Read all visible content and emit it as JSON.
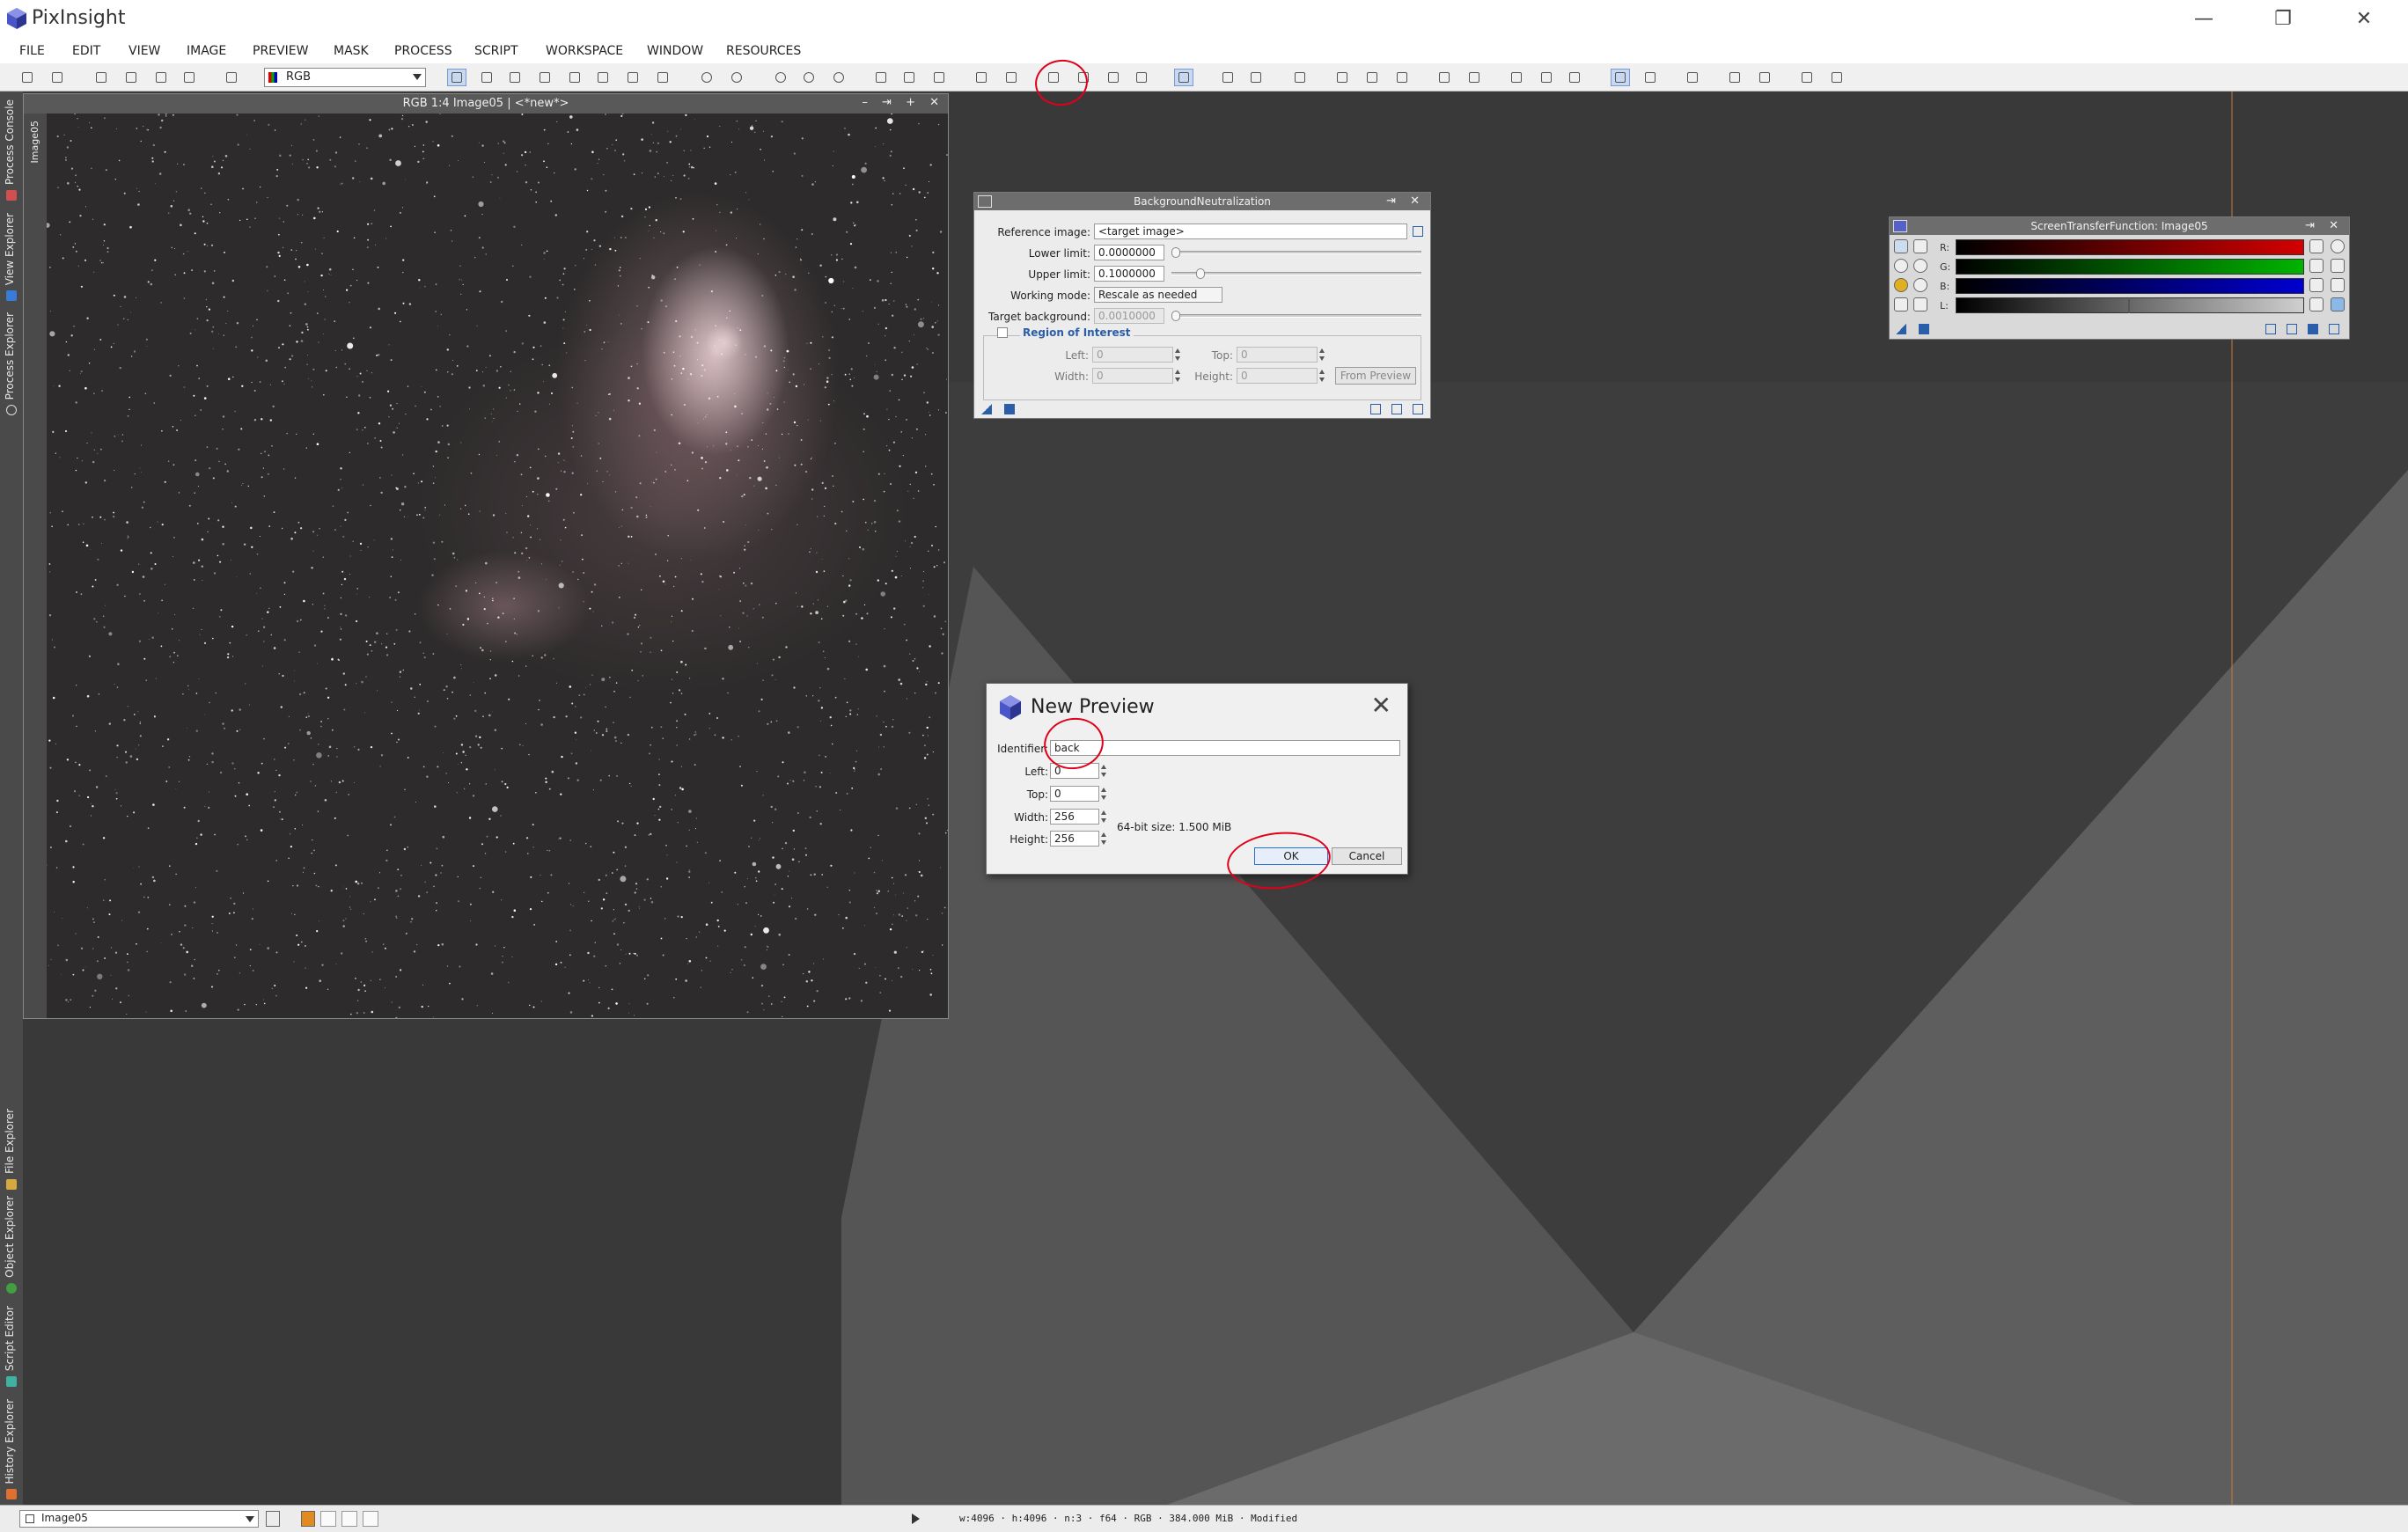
{
  "app": {
    "title": "PixInsight",
    "minimize": "—",
    "restore": "❐",
    "close": "✕"
  },
  "menu": [
    "FILE",
    "EDIT",
    "VIEW",
    "IMAGE",
    "PREVIEW",
    "MASK",
    "PROCESS",
    "SCRIPT",
    "WORKSPACE",
    "WINDOW",
    "RESOURCES"
  ],
  "toolbar": {
    "view_selector": "RGB"
  },
  "left_dock": {
    "tabs": [
      "Process Console",
      "View Explorer",
      "Process Explorer",
      "File Explorer",
      "Object Explorer",
      "Script Editor",
      "History Explorer"
    ]
  },
  "image_window": {
    "title": "RGB 1:4 Image05 | <*new*>",
    "side_label": "Image05",
    "controls": "– ⇥ + ✕"
  },
  "background_neutralization": {
    "title": "BackgroundNeutralization",
    "controls": "⇥ ✕",
    "reference_image_label": "Reference image:",
    "reference_image_value": "<target image>",
    "lower_limit_label": "Lower limit:",
    "lower_limit_value": "0.0000000",
    "upper_limit_label": "Upper limit:",
    "upper_limit_value": "0.1000000",
    "working_mode_label": "Working mode:",
    "working_mode_value": "Rescale as needed",
    "target_background_label": "Target background:",
    "target_background_value": "0.0010000",
    "roi_label": "Region of Interest",
    "left_label": "Left:",
    "left_value": "0",
    "top_label": "Top:",
    "top_value": "0",
    "width_label": "Width:",
    "width_value": "0",
    "height_label": "Height:",
    "height_value": "0",
    "from_preview": "From Preview"
  },
  "stf": {
    "title": "ScreenTransferFunction: Image05",
    "controls": "⇥ ✕",
    "channels": [
      {
        "label": "R:",
        "color": "#d40000"
      },
      {
        "label": "G:",
        "color": "#00b400"
      },
      {
        "label": "B:",
        "color": "#0000d0"
      },
      {
        "label": "L:",
        "color": "#cfcfcf"
      }
    ]
  },
  "new_preview": {
    "title": "New Preview",
    "close": "✕",
    "identifier_label": "Identifier:",
    "identifier_value": "back",
    "left_label": "Left:",
    "left_value": "0",
    "top_label": "Top:",
    "top_value": "0",
    "width_label": "Width:",
    "width_value": "256",
    "height_label": "Height:",
    "height_value": "256",
    "size_info": "64-bit size: 1.500 MiB",
    "ok_label": "OK",
    "cancel_label": "Cancel"
  },
  "status": {
    "view": "Image05",
    "info": "w:4096 · h:4096 · n:3 · f64 · RGB · 384.000 MiB · Modified"
  },
  "colors": {
    "annotation": "#e0001a",
    "accent": "#2a5ea8"
  }
}
